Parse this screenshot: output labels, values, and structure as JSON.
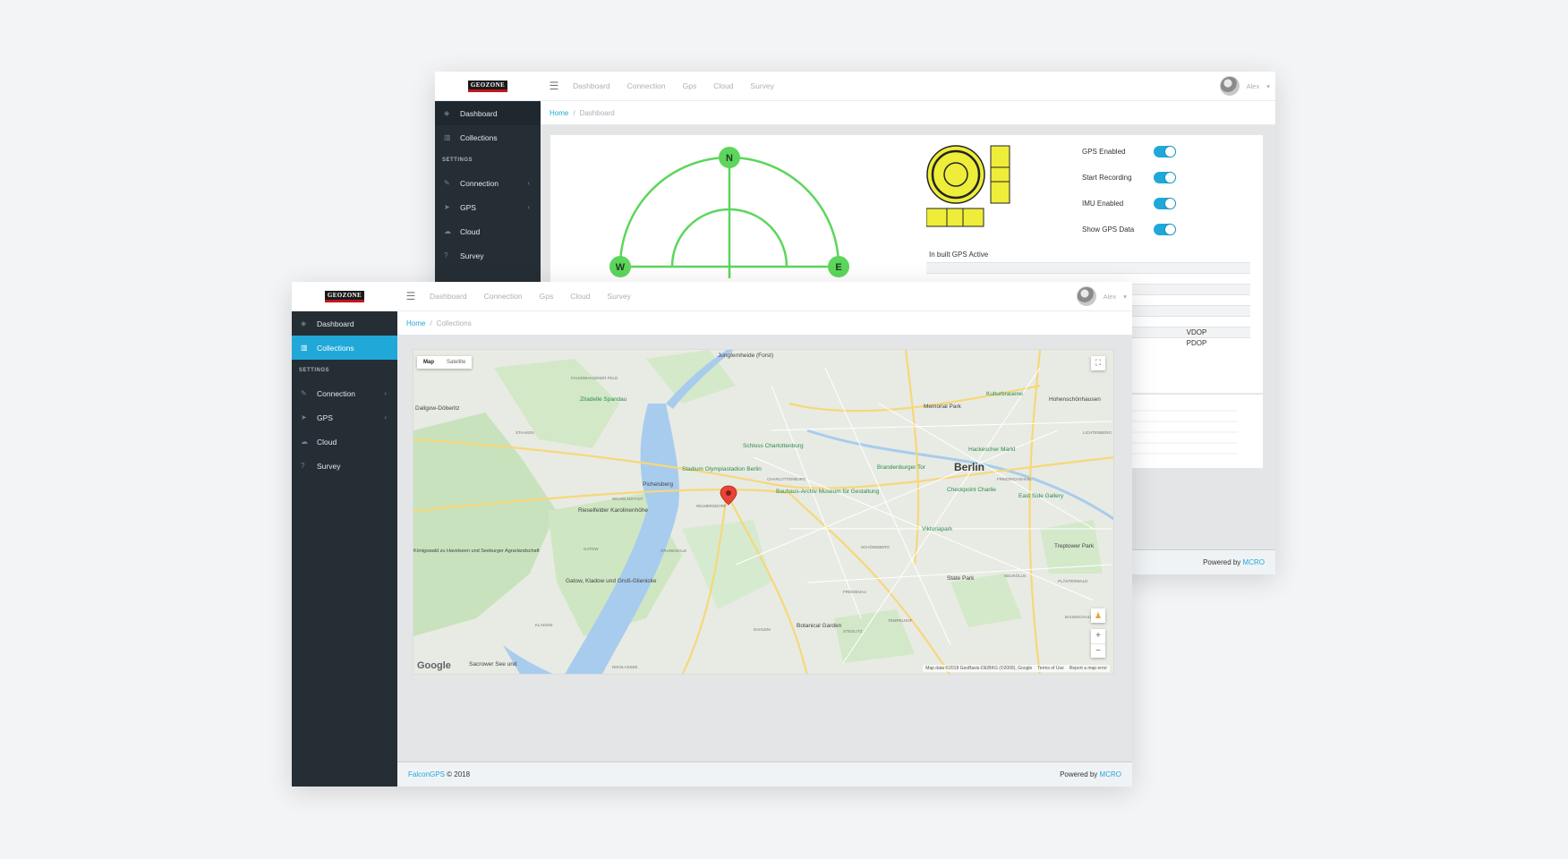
{
  "colors": {
    "accent": "#20a8d8",
    "sidebar": "#252e35",
    "compass": "#5cd65c",
    "level": "#eded3a",
    "pin": "#ea4335"
  },
  "back_window": {
    "logo": "GEOZONE",
    "menu_icon": "hamburger-icon",
    "nav": [
      "Dashboard",
      "Connection",
      "Gps",
      "Cloud",
      "Survey"
    ],
    "user": "Alex",
    "sidebar": {
      "items": [
        {
          "label": "Dashboard",
          "icon": "dashboard-icon",
          "glyph": "◈",
          "chevron": ""
        },
        {
          "label": "Collections",
          "icon": "map-icon",
          "glyph": "▥",
          "chevron": ""
        }
      ],
      "section_title": "SETTINGS",
      "settings": [
        {
          "label": "Connection",
          "icon": "plug-icon",
          "glyph": "✎",
          "chevron": "‹"
        },
        {
          "label": "GPS",
          "icon": "location-arrow-icon",
          "glyph": "➤",
          "chevron": "‹"
        },
        {
          "label": "Cloud",
          "icon": "cloud-icon",
          "glyph": "☁",
          "chevron": ""
        },
        {
          "label": "Survey",
          "icon": "question-icon",
          "glyph": "?",
          "chevron": ""
        }
      ]
    },
    "breadcrumb": {
      "home": "Home",
      "sep": "/",
      "current": "Dashboard"
    },
    "compass": {
      "north": "N",
      "west": "W",
      "east": "E"
    },
    "level_status": "In built GPS Active",
    "toggles": [
      {
        "label": "GPS Enabled",
        "on": true
      },
      {
        "label": "Start Recording",
        "on": true
      },
      {
        "label": "IMU Enabled",
        "on": true
      },
      {
        "label": "Show GPS Data",
        "on": true
      }
    ],
    "dop_rows": [
      "",
      "",
      "",
      "",
      "",
      "",
      "VDOP",
      "PDOP"
    ],
    "footer": {
      "powered_by": "Powered by",
      "brand": "MCRO"
    }
  },
  "front_window": {
    "logo": "GEOZONE",
    "menu_icon": "hamburger-icon",
    "nav": [
      "Dashboard",
      "Connection",
      "Gps",
      "Cloud",
      "Survey"
    ],
    "user": "Alex",
    "sidebar": {
      "items": [
        {
          "label": "Dashboard",
          "icon": "dashboard-icon",
          "glyph": "◈",
          "chevron": ""
        },
        {
          "label": "Collections",
          "icon": "map-icon",
          "glyph": "▥",
          "chevron": ""
        }
      ],
      "section_title": "SETTINGS",
      "settings": [
        {
          "label": "Connection",
          "icon": "plug-icon",
          "glyph": "✎",
          "chevron": "‹"
        },
        {
          "label": "GPS",
          "icon": "location-arrow-icon",
          "glyph": "➤",
          "chevron": "‹"
        },
        {
          "label": "Cloud",
          "icon": "cloud-icon",
          "glyph": "☁",
          "chevron": ""
        },
        {
          "label": "Survey",
          "icon": "question-icon",
          "glyph": "?",
          "chevron": ""
        }
      ]
    },
    "breadcrumb": {
      "home": "Home",
      "sep": "/",
      "current": "Collections"
    },
    "map": {
      "type_map": "Map",
      "type_satellite": "Satellite",
      "fullscreen_glyph": "⛶",
      "pegman_glyph": "♟",
      "zoom_in": "+",
      "zoom_out": "−",
      "google": "Google",
      "attribution": "Map data ©2018 GeoBasis-DE/BKG (©2009), Google",
      "terms": "Terms of Use",
      "report": "Report a map error",
      "city": "Berlin",
      "labels": [
        {
          "text": "Zitadelle Spandau",
          "cls": "green"
        },
        {
          "text": "Schloss Charlottenburg",
          "cls": "green"
        },
        {
          "text": "Stadium Olympiastadion Berlin",
          "cls": "green"
        },
        {
          "text": "Bauhaus-Archiv Museum für Gestaltung",
          "cls": "green"
        },
        {
          "text": "Brandenburger Tor",
          "cls": "green"
        },
        {
          "text": "Hackescher Markt",
          "cls": "green"
        },
        {
          "text": "Checkpoint Charlie",
          "cls": "green"
        },
        {
          "text": "East Side Gallery",
          "cls": "green"
        },
        {
          "text": "Kulturbrauerei",
          "cls": "green"
        },
        {
          "text": "Viktoriapark",
          "cls": "green"
        },
        {
          "text": "Pichelsberg",
          "cls": ""
        },
        {
          "text": "Rieselfelder Karolinenhöhe",
          "cls": ""
        },
        {
          "text": "Gatow, Kladow und Groß-Glienicke",
          "cls": ""
        },
        {
          "text": "Königswald zu Havelseen und Seeburger Agrarlandschaft",
          "cls": ""
        },
        {
          "text": "Botanical Garden",
          "cls": ""
        },
        {
          "text": "State Park",
          "cls": ""
        },
        {
          "text": "Treptower Park",
          "cls": ""
        },
        {
          "text": "Memorial Park",
          "cls": ""
        },
        {
          "text": "Sacrower See und",
          "cls": ""
        },
        {
          "text": "Hohenschönhausen",
          "cls": ""
        },
        {
          "text": "Jungfernheide (Forst)",
          "cls": ""
        },
        {
          "text": "Dallgow-Döberitz",
          "cls": ""
        },
        {
          "text": "CHARLOTTENBURG",
          "cls": "small"
        },
        {
          "text": "WILMERSDORF",
          "cls": "small"
        },
        {
          "text": "SCHÖNEBERG",
          "cls": "small"
        },
        {
          "text": "TEMPELHOF",
          "cls": "small"
        },
        {
          "text": "NEUKÖLLN",
          "cls": "small"
        },
        {
          "text": "FRIEDRICHSHAIN",
          "cls": "small"
        },
        {
          "text": "DAHLEM",
          "cls": "small"
        },
        {
          "text": "STAAKEN",
          "cls": "small"
        },
        {
          "text": "GATOW",
          "cls": "small"
        },
        {
          "text": "KLADOW",
          "cls": "small"
        },
        {
          "text": "FALKENHAGENER FELD",
          "cls": "small"
        },
        {
          "text": "WILHELMSTADT",
          "cls": "small"
        },
        {
          "text": "GRUNEWALD",
          "cls": "small"
        },
        {
          "text": "NIKOLASSEE",
          "cls": "small"
        },
        {
          "text": "FRIEDENAU",
          "cls": "small"
        },
        {
          "text": "STEGLITZ",
          "cls": "small"
        },
        {
          "text": "LICHTENBERG",
          "cls": "small"
        },
        {
          "text": "PLÄNTERWALD",
          "cls": "small"
        },
        {
          "text": "BAUMSCHULENWEG",
          "cls": "small"
        }
      ]
    },
    "footer": {
      "app": "FalconGPS",
      "copy": "© 2018",
      "powered_by": "Powered by",
      "brand": "MCRO"
    }
  }
}
